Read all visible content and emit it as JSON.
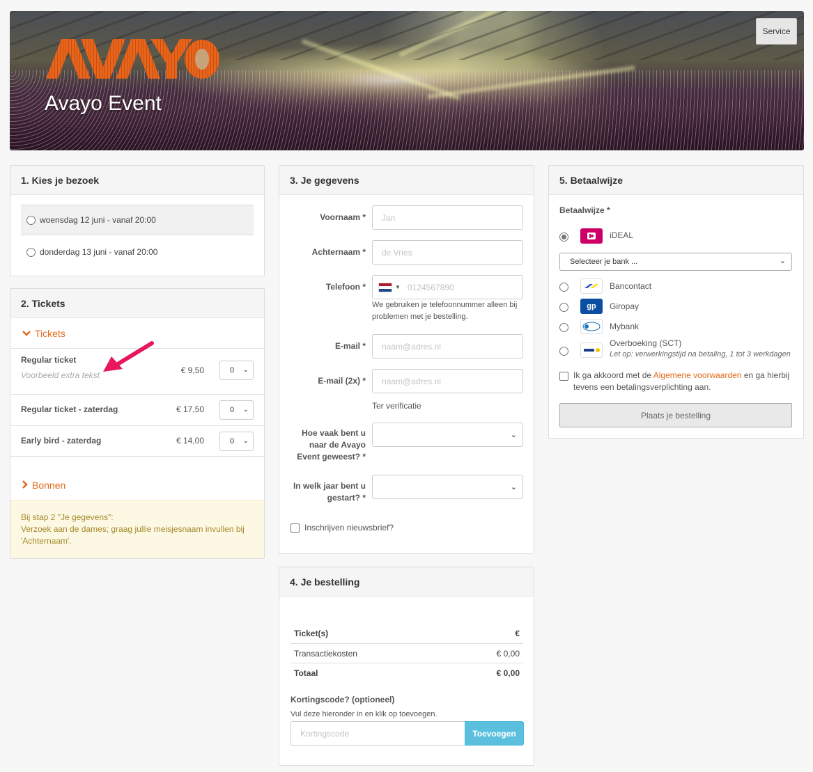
{
  "header": {
    "logo_text": "AVAYO",
    "event_title": "Avayo Event",
    "service_label": "Service"
  },
  "visit": {
    "title": "1. Kies je bezoek",
    "options": [
      {
        "label": "woensdag 12 juni - vanaf 20:00",
        "selected": false
      },
      {
        "label": "donderdag 13 juni - vanaf 20:00",
        "selected": false
      }
    ]
  },
  "tickets": {
    "title": "2. Tickets",
    "section_label": "Tickets",
    "items": [
      {
        "name": "Regular ticket",
        "note": "Voorbeeld extra tekst",
        "price": "€ 9,50",
        "qty": "0"
      },
      {
        "name": "Regular ticket - zaterdag",
        "note": "",
        "price": "€ 17,50",
        "qty": "0"
      },
      {
        "name": "Early bird - zaterdag",
        "note": "",
        "price": "€ 14,00",
        "qty": "0"
      }
    ],
    "bonnen_label": "Bonnen",
    "notice_lines": [
      "Bij stap 2 \"Je gegevens\":",
      "Verzoek aan de dames; graag jullie meisjesnaam invullen bij",
      "'Achternaam'."
    ]
  },
  "details": {
    "title": "3. Je gegevens",
    "fields": {
      "voornaam": {
        "label": "Voornaam *",
        "placeholder": "Jan"
      },
      "achternaam": {
        "label": "Achternaam *",
        "placeholder": "de Vries"
      },
      "telefoon": {
        "label": "Telefoon *",
        "placeholder": "0124567890",
        "help": [
          "We gebruiken je telefoonnummer alleen bij",
          "problemen met je bestelling."
        ]
      },
      "email": {
        "label": "E-mail *",
        "placeholder": "naam@adres.nl"
      },
      "email2": {
        "label": "E-mail (2x) *",
        "placeholder": "naam@adres.nl",
        "help": "Ter verificatie"
      },
      "hoe_vaak": {
        "label_lines": [
          "Hoe vaak bent u",
          "naar de Avayo",
          "Event geweest? *"
        ],
        "value": ""
      },
      "jaar": {
        "label_lines": [
          "In welk jaar bent u",
          "gestart? *"
        ],
        "value": ""
      }
    },
    "newsletter_label": "Inschrijven nieuwsbrief?"
  },
  "order": {
    "title": "4. Je bestelling",
    "rows": [
      {
        "label": "Ticket(s)",
        "value": "€",
        "bold": true
      },
      {
        "label": "Transactiekosten",
        "value": "€ 0,00",
        "bold": false
      },
      {
        "label": "Totaal",
        "value": "€ 0,00",
        "bold": true
      }
    ],
    "discount_title": "Kortingscode? (optioneel)",
    "discount_help": "Vul deze hieronder in en klik op toevoegen.",
    "discount_placeholder": "Kortingscode",
    "add_button": "Toevoegen"
  },
  "payment": {
    "title": "5. Betaalwijze",
    "label": "Betaalwijze *",
    "methods": [
      {
        "name": "iDEAL",
        "icon": "ideal-icon",
        "selected": true
      },
      {
        "name": "Bancontact",
        "icon": "bancontact-icon",
        "selected": false
      },
      {
        "name": "Giropay",
        "icon": "giropay-icon",
        "selected": false
      },
      {
        "name": "Mybank",
        "icon": "mybank-icon",
        "selected": false
      },
      {
        "name": "Overboeking (SCT)",
        "icon": "sepa-icon",
        "selected": false,
        "note": "Let op: verwerkingstijd na betaling, 1 tot 3 werkdagen"
      }
    ],
    "bank_select": "Selecteer je bank ...",
    "terms": {
      "pre": "Ik ga akkoord met de ",
      "link": "Algemene voorwaarden",
      "post": " en ga hierbij",
      "line2": "tevens een betalingsverplichting aan."
    },
    "order_button": "Plaats je bestelling"
  },
  "colors": {
    "accent": "#e06a1b",
    "button_blue": "#5bc0de",
    "notice_bg": "#fcf8e3",
    "arrow": "#e8175d"
  }
}
